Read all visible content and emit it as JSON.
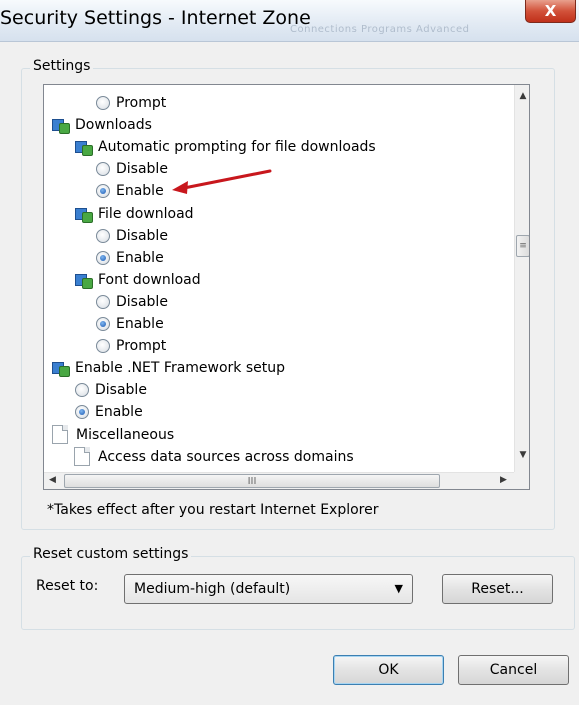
{
  "window": {
    "title": "Security Settings - Internet Zone",
    "close_glyph": "X",
    "background_tabs_text": "Connections   Programs   Advanced"
  },
  "settings_group": {
    "label": "Settings",
    "tree": [
      {
        "kind": "radio",
        "label": "Prompt",
        "checked": false,
        "indent": 2
      },
      {
        "kind": "setting",
        "label": "Downloads",
        "indent": 0
      },
      {
        "kind": "setting",
        "label": "Automatic prompting for file downloads",
        "indent": 1
      },
      {
        "kind": "radio",
        "label": "Disable",
        "checked": false,
        "indent": 2
      },
      {
        "kind": "radio",
        "label": "Enable",
        "checked": true,
        "indent": 2
      },
      {
        "kind": "setting",
        "label": "File download",
        "indent": 1
      },
      {
        "kind": "radio",
        "label": "Disable",
        "checked": false,
        "indent": 2
      },
      {
        "kind": "radio",
        "label": "Enable",
        "checked": true,
        "indent": 2
      },
      {
        "kind": "setting",
        "label": "Font download",
        "indent": 1
      },
      {
        "kind": "radio",
        "label": "Disable",
        "checked": false,
        "indent": 2
      },
      {
        "kind": "radio",
        "label": "Enable",
        "checked": true,
        "indent": 2
      },
      {
        "kind": "radio",
        "label": "Prompt",
        "checked": false,
        "indent": 2
      },
      {
        "kind": "setting",
        "label": "Enable .NET Framework setup",
        "indent": 0
      },
      {
        "kind": "radio",
        "label": "Disable",
        "checked": false,
        "indent": 1
      },
      {
        "kind": "radio",
        "label": "Enable",
        "checked": true,
        "indent": 1
      },
      {
        "kind": "folder",
        "label": "Miscellaneous",
        "indent": 0
      },
      {
        "kind": "folder",
        "label": "Access data sources across domains",
        "indent": 1
      }
    ],
    "hscroll_grip": "III",
    "vscroll_grip": "≡",
    "note": "*Takes effect after you restart Internet Explorer"
  },
  "reset_group": {
    "label": "Reset custom settings",
    "reset_to_label": "Reset to:",
    "selected_level": "Medium-high (default)",
    "reset_button": "Reset..."
  },
  "footer": {
    "ok_button": "OK",
    "cancel_button": "Cancel"
  },
  "colors": {
    "annotation_arrow": "#c8171d",
    "radio_selected": "#1c5ab2"
  }
}
